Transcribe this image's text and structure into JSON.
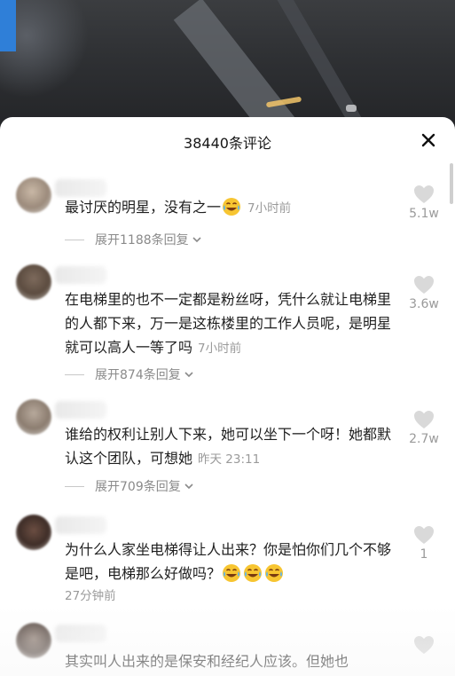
{
  "panel": {
    "title": "38440条评论",
    "close_icon": "close-icon"
  },
  "comments": [
    {
      "text": "最讨厌的明星，没有之一",
      "emoji": [
        "laughing-tears-emoji"
      ],
      "time": "7小时前",
      "likes": "5.1w",
      "replies": "展开1188条回复"
    },
    {
      "text": "在电梯里的也不一定都是粉丝呀，凭什么就让电梯里的人都下来，万一是这栋楼里的工作人员呢，是明星就可以高人一等了吗",
      "time": "7小时前",
      "likes": "3.6w",
      "replies": "展开874条回复"
    },
    {
      "text": "谁给的权利让别人下来，她可以坐下一个呀！她都默认这个团队，可想她",
      "time": "昨天 23:11",
      "likes": "2.7w",
      "replies": "展开709条回复"
    },
    {
      "text": "为什么人家坐电梯得让人出来？你是怕你们几个不够是吧，电梯那么好做吗？",
      "emoji": [
        "laughing-tears-emoji",
        "laughing-tears-emoji",
        "laughing-tears-emoji"
      ],
      "time": "27分钟前",
      "likes": "1"
    },
    {
      "text": "其实叫人出来的是保安和经纪人应该。但她也"
    }
  ],
  "colors": {
    "panel_bg": "#ffffff",
    "text": "#1f1f1f",
    "muted": "#9a9a9a"
  }
}
